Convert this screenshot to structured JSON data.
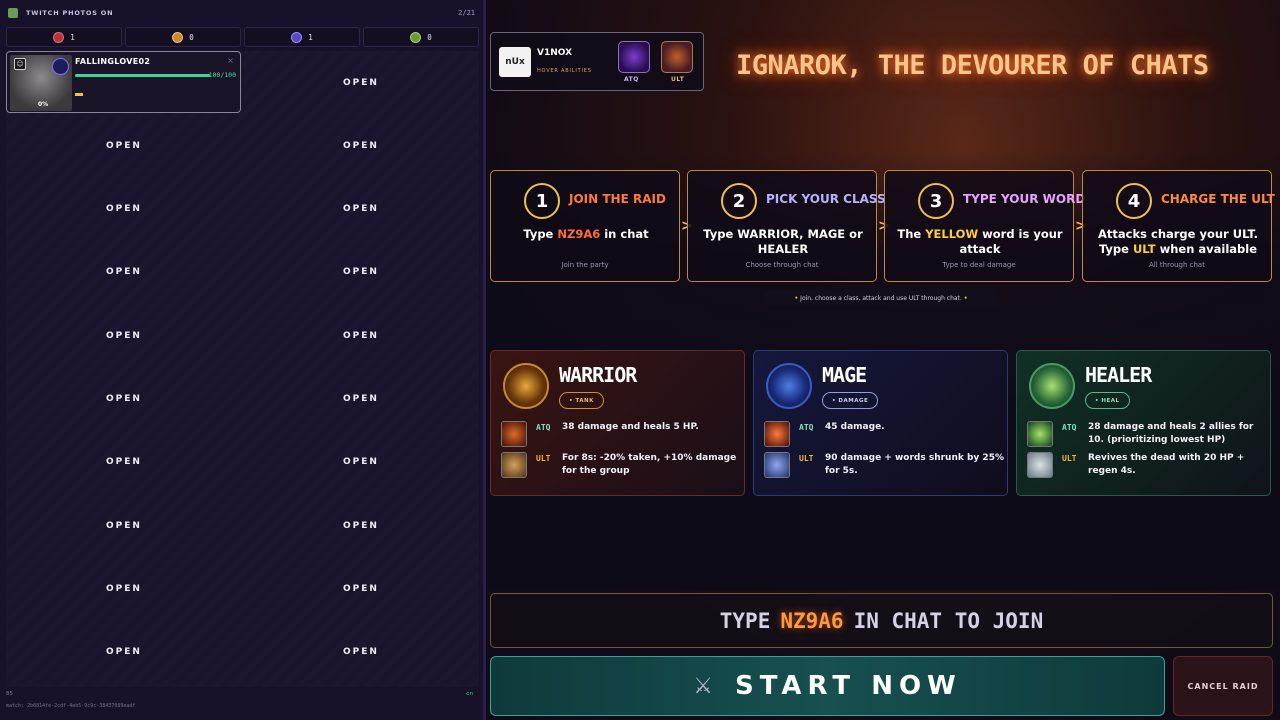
{
  "left_panel": {
    "title": "TWITCH PHOTOS ON",
    "count": "2/21",
    "tallies": [
      {
        "icon": "warrior-class-icon",
        "value": "1",
        "color": "#b8323a"
      },
      {
        "icon": "tank-class-icon",
        "value": "0",
        "color": "#c98b2e"
      },
      {
        "icon": "mage-class-icon",
        "value": "1",
        "color": "#5a46c8"
      },
      {
        "icon": "healer-class-icon",
        "value": "0",
        "color": "#6c9a3a"
      }
    ],
    "player": {
      "name": "FALLINGLOVE02",
      "hp": "100/100",
      "hp_fraction": 1.0,
      "percent": "0%"
    },
    "open_label": "OPEN",
    "footer_label": "85",
    "footer_status": "on",
    "match_id": "match: 2b6814fe-2cdf-4eb5-9c9c-38437089eadf"
  },
  "streamer": {
    "logo_text": "nUx",
    "name": "V1NOX",
    "hover_hint": "HOVER ABILITIES",
    "atq_label": "ATQ",
    "ult_label": "ULT"
  },
  "boss": {
    "title": "IGNAROK, THE DEVOURER OF CHATS"
  },
  "steps": [
    {
      "num": "1",
      "title": "JOIN THE RAID",
      "title_color": "#ff7a3a",
      "main_pre": "Type ",
      "main_hl": "NZ9A6",
      "main_post": " in chat",
      "sub": "Join the party"
    },
    {
      "num": "2",
      "title": "PICK YOUR CLASS",
      "title_color": "#b9b3ff",
      "main_pre": "Type WARRIOR, MAGE or HEALER",
      "main_hl": "",
      "main_post": "",
      "sub": "Choose through chat"
    },
    {
      "num": "3",
      "title": "TYPE YOUR WORD",
      "title_color": "#e9a4ff",
      "main_pre": "The ",
      "main_hl": "YELLOW",
      "main_post": " word is your attack",
      "sub": "Type to deal damage"
    },
    {
      "num": "4",
      "title": "CHARGE THE ULT",
      "title_color": "#ff8a3a",
      "main_pre": "Attacks charge your ULT. Type ",
      "main_hl": "ULT",
      "main_post": " when available",
      "sub": "All through chat"
    }
  ],
  "hint": "Join, choose a class, attack and use ULT through chat.",
  "classes": [
    {
      "name": "WARRIOR",
      "role": "• TANK",
      "atq_tag": "ATQ",
      "atq": "38 damage and heals 5 HP.",
      "ult_tag": "ULT",
      "ult": "For 8s: -20% taken, +10% damage for the group"
    },
    {
      "name": "MAGE",
      "role": "• DAMAGE",
      "atq_tag": "ATQ",
      "atq": "45 damage.",
      "ult_tag": "ULT",
      "ult": "90 damage + words shrunk by 25% for 5s."
    },
    {
      "name": "HEALER",
      "role": "• HEAL",
      "atq_tag": "ATQ",
      "atq": "28 damage and heals 2 allies for 10. (prioritizing lowest HP)",
      "ult_tag": "ULT",
      "ult": "Revives the dead with 20 HP + regen 4s."
    }
  ],
  "join_banner": {
    "pre": "TYPE",
    "code": "NZ9A6",
    "post": "IN CHAT TO JOIN"
  },
  "start_button": {
    "icon": "crossed-swords-icon",
    "label": "START NOW"
  },
  "cancel_button": {
    "label": "CANCEL RAID"
  }
}
